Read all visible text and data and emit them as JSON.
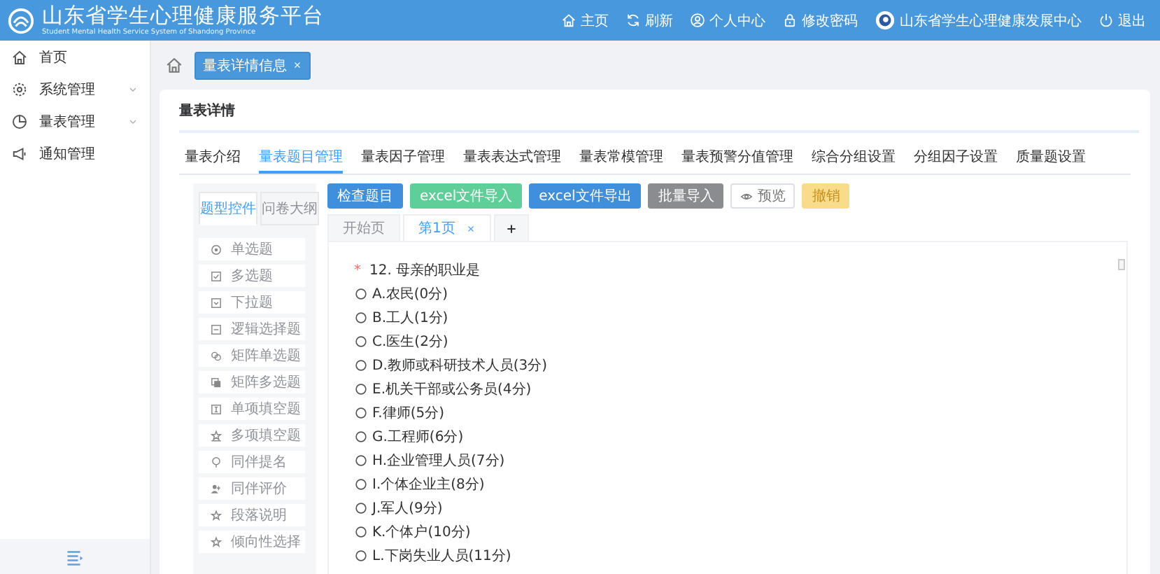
{
  "header": {
    "title": "山东省学生心理健康服务平台",
    "subtitle": "Student Mental Health Service System of Shandong Province",
    "nav": [
      {
        "label": "主页"
      },
      {
        "label": "刷新"
      },
      {
        "label": "个人中心"
      },
      {
        "label": "修改密码"
      },
      {
        "label": "山东省学生心理健康发展中心"
      },
      {
        "label": "退出"
      }
    ]
  },
  "sidebar": {
    "items": [
      {
        "label": "首页",
        "submenu": false,
        "selected": false
      },
      {
        "label": "系统管理",
        "submenu": true,
        "selected": false
      },
      {
        "label": "量表管理",
        "submenu": true,
        "selected": false
      },
      {
        "label": "通知管理",
        "submenu": false,
        "selected": false
      }
    ]
  },
  "breadcrumb": {
    "tags": [
      {
        "label": "量表详情信息",
        "selected": true
      }
    ]
  },
  "card": {
    "title": "量表详情",
    "tabs": [
      {
        "label": "量表介绍",
        "selected": false
      },
      {
        "label": "量表题目管理",
        "selected": true
      },
      {
        "label": "量表因子管理",
        "selected": false
      },
      {
        "label": "量表表达式管理",
        "selected": false
      },
      {
        "label": "量表常模管理",
        "selected": false
      },
      {
        "label": "量表预警分值管理",
        "selected": false
      },
      {
        "label": "综合分组设置",
        "selected": false
      },
      {
        "label": "分组因子设置",
        "selected": false
      },
      {
        "label": "质量题设置",
        "selected": false
      }
    ],
    "palette": {
      "tabs": [
        {
          "label": "题型控件",
          "selected": true
        },
        {
          "label": "问卷大纲",
          "selected": false
        }
      ],
      "items": [
        {
          "label": "单选题"
        },
        {
          "label": "多选题"
        },
        {
          "label": "下拉题"
        },
        {
          "label": "逻辑选择题"
        },
        {
          "label": "矩阵单选题"
        },
        {
          "label": "矩阵多选题"
        },
        {
          "label": "单项填空题"
        },
        {
          "label": "多项填空题"
        },
        {
          "label": "同伴提名"
        },
        {
          "label": "同伴评价"
        },
        {
          "label": "段落说明"
        },
        {
          "label": "倾向性选择"
        }
      ]
    },
    "toolbar": [
      {
        "label": "检查题目",
        "kind": "primary"
      },
      {
        "label": "excel文件导入",
        "kind": "success"
      },
      {
        "label": "excel文件导出",
        "kind": "primary"
      },
      {
        "label": "批量导入",
        "kind": "info"
      },
      {
        "label": "预览",
        "kind": "preview"
      },
      {
        "label": "撤销",
        "kind": "warning"
      }
    ],
    "page_tabs": [
      {
        "label": "开始页",
        "selected": false,
        "closable": false
      },
      {
        "label": "第1页",
        "selected": true,
        "closable": true
      }
    ],
    "question": {
      "required_mark": "*",
      "title": "12. 母亲的职业是",
      "options": [
        {
          "label": "A.农民(0分)",
          "selected": false
        },
        {
          "label": "B.工人(1分)",
          "selected": false
        },
        {
          "label": "C.医生(2分)",
          "selected": false
        },
        {
          "label": "D.教师或科研技术人员(3分)",
          "selected": false
        },
        {
          "label": "E.机关干部或公务员(4分)",
          "selected": false
        },
        {
          "label": "F.律师(5分)",
          "selected": false
        },
        {
          "label": "G.工程师(6分)",
          "selected": false
        },
        {
          "label": "H.企业管理人员(7分)",
          "selected": false
        },
        {
          "label": "I.个体企业主(8分)",
          "selected": false
        },
        {
          "label": "J.军人(9分)",
          "selected": false
        },
        {
          "label": "K.个体户(10分)",
          "selected": false
        },
        {
          "label": "L.下岗失业人员(11分)",
          "selected": false
        }
      ]
    }
  }
}
